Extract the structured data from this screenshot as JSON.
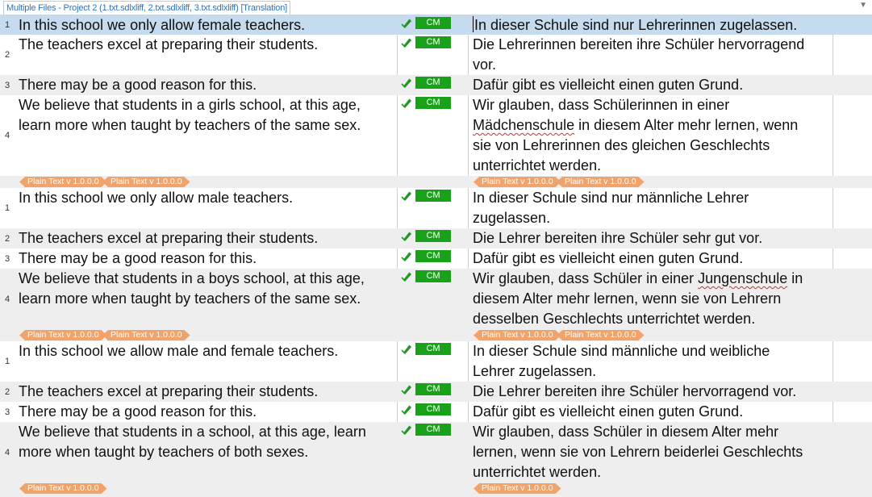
{
  "tab": {
    "title": "Multiple Files - Project 2 (1.txt.sdlxliff, 2.txt.sdlxliff, 3.txt.sdlxliff) [Translation]"
  },
  "status_label": "CM",
  "tag_label": "Plain Text v 1.0.0.0",
  "segments": [
    {
      "num": "1",
      "src": "In this school we only allow female teachers.",
      "tgt": "In dieser Schule sind nur Lehrerinnen zugelassen."
    },
    {
      "num": "2",
      "src": "The teachers excel at preparing their students.",
      "tgt_l1": "Die Lehrerinnen bereiten ihre Schüler hervorragend",
      "tgt_l2": "vor."
    },
    {
      "num": "3",
      "src": "There may be a good reason for this.",
      "tgt": "Dafür gibt es vielleicht einen guten Grund."
    },
    {
      "num": "4",
      "src_l1": "We believe that students in a girls school, at this age,",
      "src_l2": "learn more when taught by teachers of the same sex.",
      "tgt_l1": "Wir glauben, dass Schülerinnen in einer",
      "tgt_l2_word": "Mädchenschule",
      "tgt_l2_rest": " in diesem Alter mehr lernen, wenn",
      "tgt_l3": "sie von Lehrerinnen des gleichen Geschlechts",
      "tgt_l4": "unterrichtet werden."
    },
    {
      "num": "1",
      "src": "In this school we only allow male teachers.",
      "tgt_l1": "In dieser Schule sind nur männliche Lehrer",
      "tgt_l2": "zugelassen."
    },
    {
      "num": "2",
      "src": "The teachers excel at preparing their students.",
      "tgt": "Die Lehrer bereiten ihre Schüler sehr gut vor."
    },
    {
      "num": "3",
      "src": "There may be a good reason for this.",
      "tgt": "Dafür gibt es vielleicht einen guten Grund."
    },
    {
      "num": "4",
      "src_l1": "We believe that students in a boys school, at this age,",
      "src_l2": "learn more when taught by teachers of the same sex.",
      "tgt_l1_pre": "Wir glauben, dass Schüler in einer ",
      "tgt_l1_word": "Jungenschule",
      "tgt_l1_post": " in",
      "tgt_l2": "diesem Alter mehr lernen, wenn sie von Lehrern",
      "tgt_l3": "desselben Geschlechts unterrichtet werden."
    },
    {
      "num": "1",
      "src": "In this school we allow male and female teachers.",
      "tgt_l1": "In dieser Schule sind männliche und weibliche",
      "tgt_l2": "Lehrer zugelassen."
    },
    {
      "num": "2",
      "src": "The teachers excel at preparing their students.",
      "tgt": "Die Lehrer bereiten ihre Schüler hervorragend vor."
    },
    {
      "num": "3",
      "src": "There may be a good reason for this.",
      "tgt": "Dafür gibt es vielleicht einen guten Grund."
    },
    {
      "num": "4",
      "src_l1": "We believe that students in a school, at this age, learn",
      "src_l2": "more when taught by teachers of both sexes.",
      "tgt_l1": "Wir glauben, dass Schüler in diesem Alter mehr",
      "tgt_l2": "lernen, wenn sie von Lehrern beiderlei Geschlechts",
      "tgt_l3": "unterrichtet werden."
    }
  ]
}
